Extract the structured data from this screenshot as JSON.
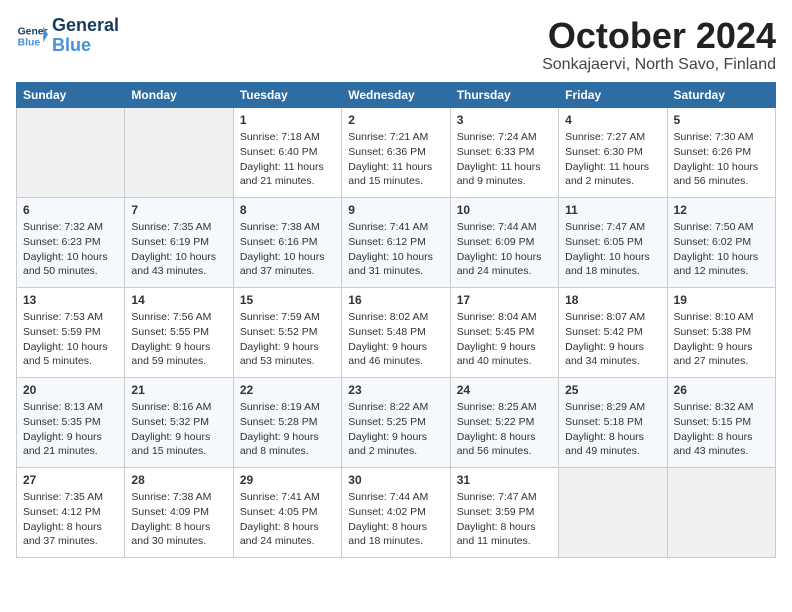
{
  "header": {
    "logo_line1": "General",
    "logo_line2": "Blue",
    "title": "October 2024",
    "subtitle": "Sonkajaervi, North Savo, Finland"
  },
  "weekdays": [
    "Sunday",
    "Monday",
    "Tuesday",
    "Wednesday",
    "Thursday",
    "Friday",
    "Saturday"
  ],
  "weeks": [
    [
      {
        "day": "",
        "content": ""
      },
      {
        "day": "",
        "content": ""
      },
      {
        "day": "1",
        "content": "Sunrise: 7:18 AM\nSunset: 6:40 PM\nDaylight: 11 hours\nand 21 minutes."
      },
      {
        "day": "2",
        "content": "Sunrise: 7:21 AM\nSunset: 6:36 PM\nDaylight: 11 hours\nand 15 minutes."
      },
      {
        "day": "3",
        "content": "Sunrise: 7:24 AM\nSunset: 6:33 PM\nDaylight: 11 hours\nand 9 minutes."
      },
      {
        "day": "4",
        "content": "Sunrise: 7:27 AM\nSunset: 6:30 PM\nDaylight: 11 hours\nand 2 minutes."
      },
      {
        "day": "5",
        "content": "Sunrise: 7:30 AM\nSunset: 6:26 PM\nDaylight: 10 hours\nand 56 minutes."
      }
    ],
    [
      {
        "day": "6",
        "content": "Sunrise: 7:32 AM\nSunset: 6:23 PM\nDaylight: 10 hours\nand 50 minutes."
      },
      {
        "day": "7",
        "content": "Sunrise: 7:35 AM\nSunset: 6:19 PM\nDaylight: 10 hours\nand 43 minutes."
      },
      {
        "day": "8",
        "content": "Sunrise: 7:38 AM\nSunset: 6:16 PM\nDaylight: 10 hours\nand 37 minutes."
      },
      {
        "day": "9",
        "content": "Sunrise: 7:41 AM\nSunset: 6:12 PM\nDaylight: 10 hours\nand 31 minutes."
      },
      {
        "day": "10",
        "content": "Sunrise: 7:44 AM\nSunset: 6:09 PM\nDaylight: 10 hours\nand 24 minutes."
      },
      {
        "day": "11",
        "content": "Sunrise: 7:47 AM\nSunset: 6:05 PM\nDaylight: 10 hours\nand 18 minutes."
      },
      {
        "day": "12",
        "content": "Sunrise: 7:50 AM\nSunset: 6:02 PM\nDaylight: 10 hours\nand 12 minutes."
      }
    ],
    [
      {
        "day": "13",
        "content": "Sunrise: 7:53 AM\nSunset: 5:59 PM\nDaylight: 10 hours\nand 5 minutes."
      },
      {
        "day": "14",
        "content": "Sunrise: 7:56 AM\nSunset: 5:55 PM\nDaylight: 9 hours\nand 59 minutes."
      },
      {
        "day": "15",
        "content": "Sunrise: 7:59 AM\nSunset: 5:52 PM\nDaylight: 9 hours\nand 53 minutes."
      },
      {
        "day": "16",
        "content": "Sunrise: 8:02 AM\nSunset: 5:48 PM\nDaylight: 9 hours\nand 46 minutes."
      },
      {
        "day": "17",
        "content": "Sunrise: 8:04 AM\nSunset: 5:45 PM\nDaylight: 9 hours\nand 40 minutes."
      },
      {
        "day": "18",
        "content": "Sunrise: 8:07 AM\nSunset: 5:42 PM\nDaylight: 9 hours\nand 34 minutes."
      },
      {
        "day": "19",
        "content": "Sunrise: 8:10 AM\nSunset: 5:38 PM\nDaylight: 9 hours\nand 27 minutes."
      }
    ],
    [
      {
        "day": "20",
        "content": "Sunrise: 8:13 AM\nSunset: 5:35 PM\nDaylight: 9 hours\nand 21 minutes."
      },
      {
        "day": "21",
        "content": "Sunrise: 8:16 AM\nSunset: 5:32 PM\nDaylight: 9 hours\nand 15 minutes."
      },
      {
        "day": "22",
        "content": "Sunrise: 8:19 AM\nSunset: 5:28 PM\nDaylight: 9 hours\nand 8 minutes."
      },
      {
        "day": "23",
        "content": "Sunrise: 8:22 AM\nSunset: 5:25 PM\nDaylight: 9 hours\nand 2 minutes."
      },
      {
        "day": "24",
        "content": "Sunrise: 8:25 AM\nSunset: 5:22 PM\nDaylight: 8 hours\nand 56 minutes."
      },
      {
        "day": "25",
        "content": "Sunrise: 8:29 AM\nSunset: 5:18 PM\nDaylight: 8 hours\nand 49 minutes."
      },
      {
        "day": "26",
        "content": "Sunrise: 8:32 AM\nSunset: 5:15 PM\nDaylight: 8 hours\nand 43 minutes."
      }
    ],
    [
      {
        "day": "27",
        "content": "Sunrise: 7:35 AM\nSunset: 4:12 PM\nDaylight: 8 hours\nand 37 minutes."
      },
      {
        "day": "28",
        "content": "Sunrise: 7:38 AM\nSunset: 4:09 PM\nDaylight: 8 hours\nand 30 minutes."
      },
      {
        "day": "29",
        "content": "Sunrise: 7:41 AM\nSunset: 4:05 PM\nDaylight: 8 hours\nand 24 minutes."
      },
      {
        "day": "30",
        "content": "Sunrise: 7:44 AM\nSunset: 4:02 PM\nDaylight: 8 hours\nand 18 minutes."
      },
      {
        "day": "31",
        "content": "Sunrise: 7:47 AM\nSunset: 3:59 PM\nDaylight: 8 hours\nand 11 minutes."
      },
      {
        "day": "",
        "content": ""
      },
      {
        "day": "",
        "content": ""
      }
    ]
  ]
}
